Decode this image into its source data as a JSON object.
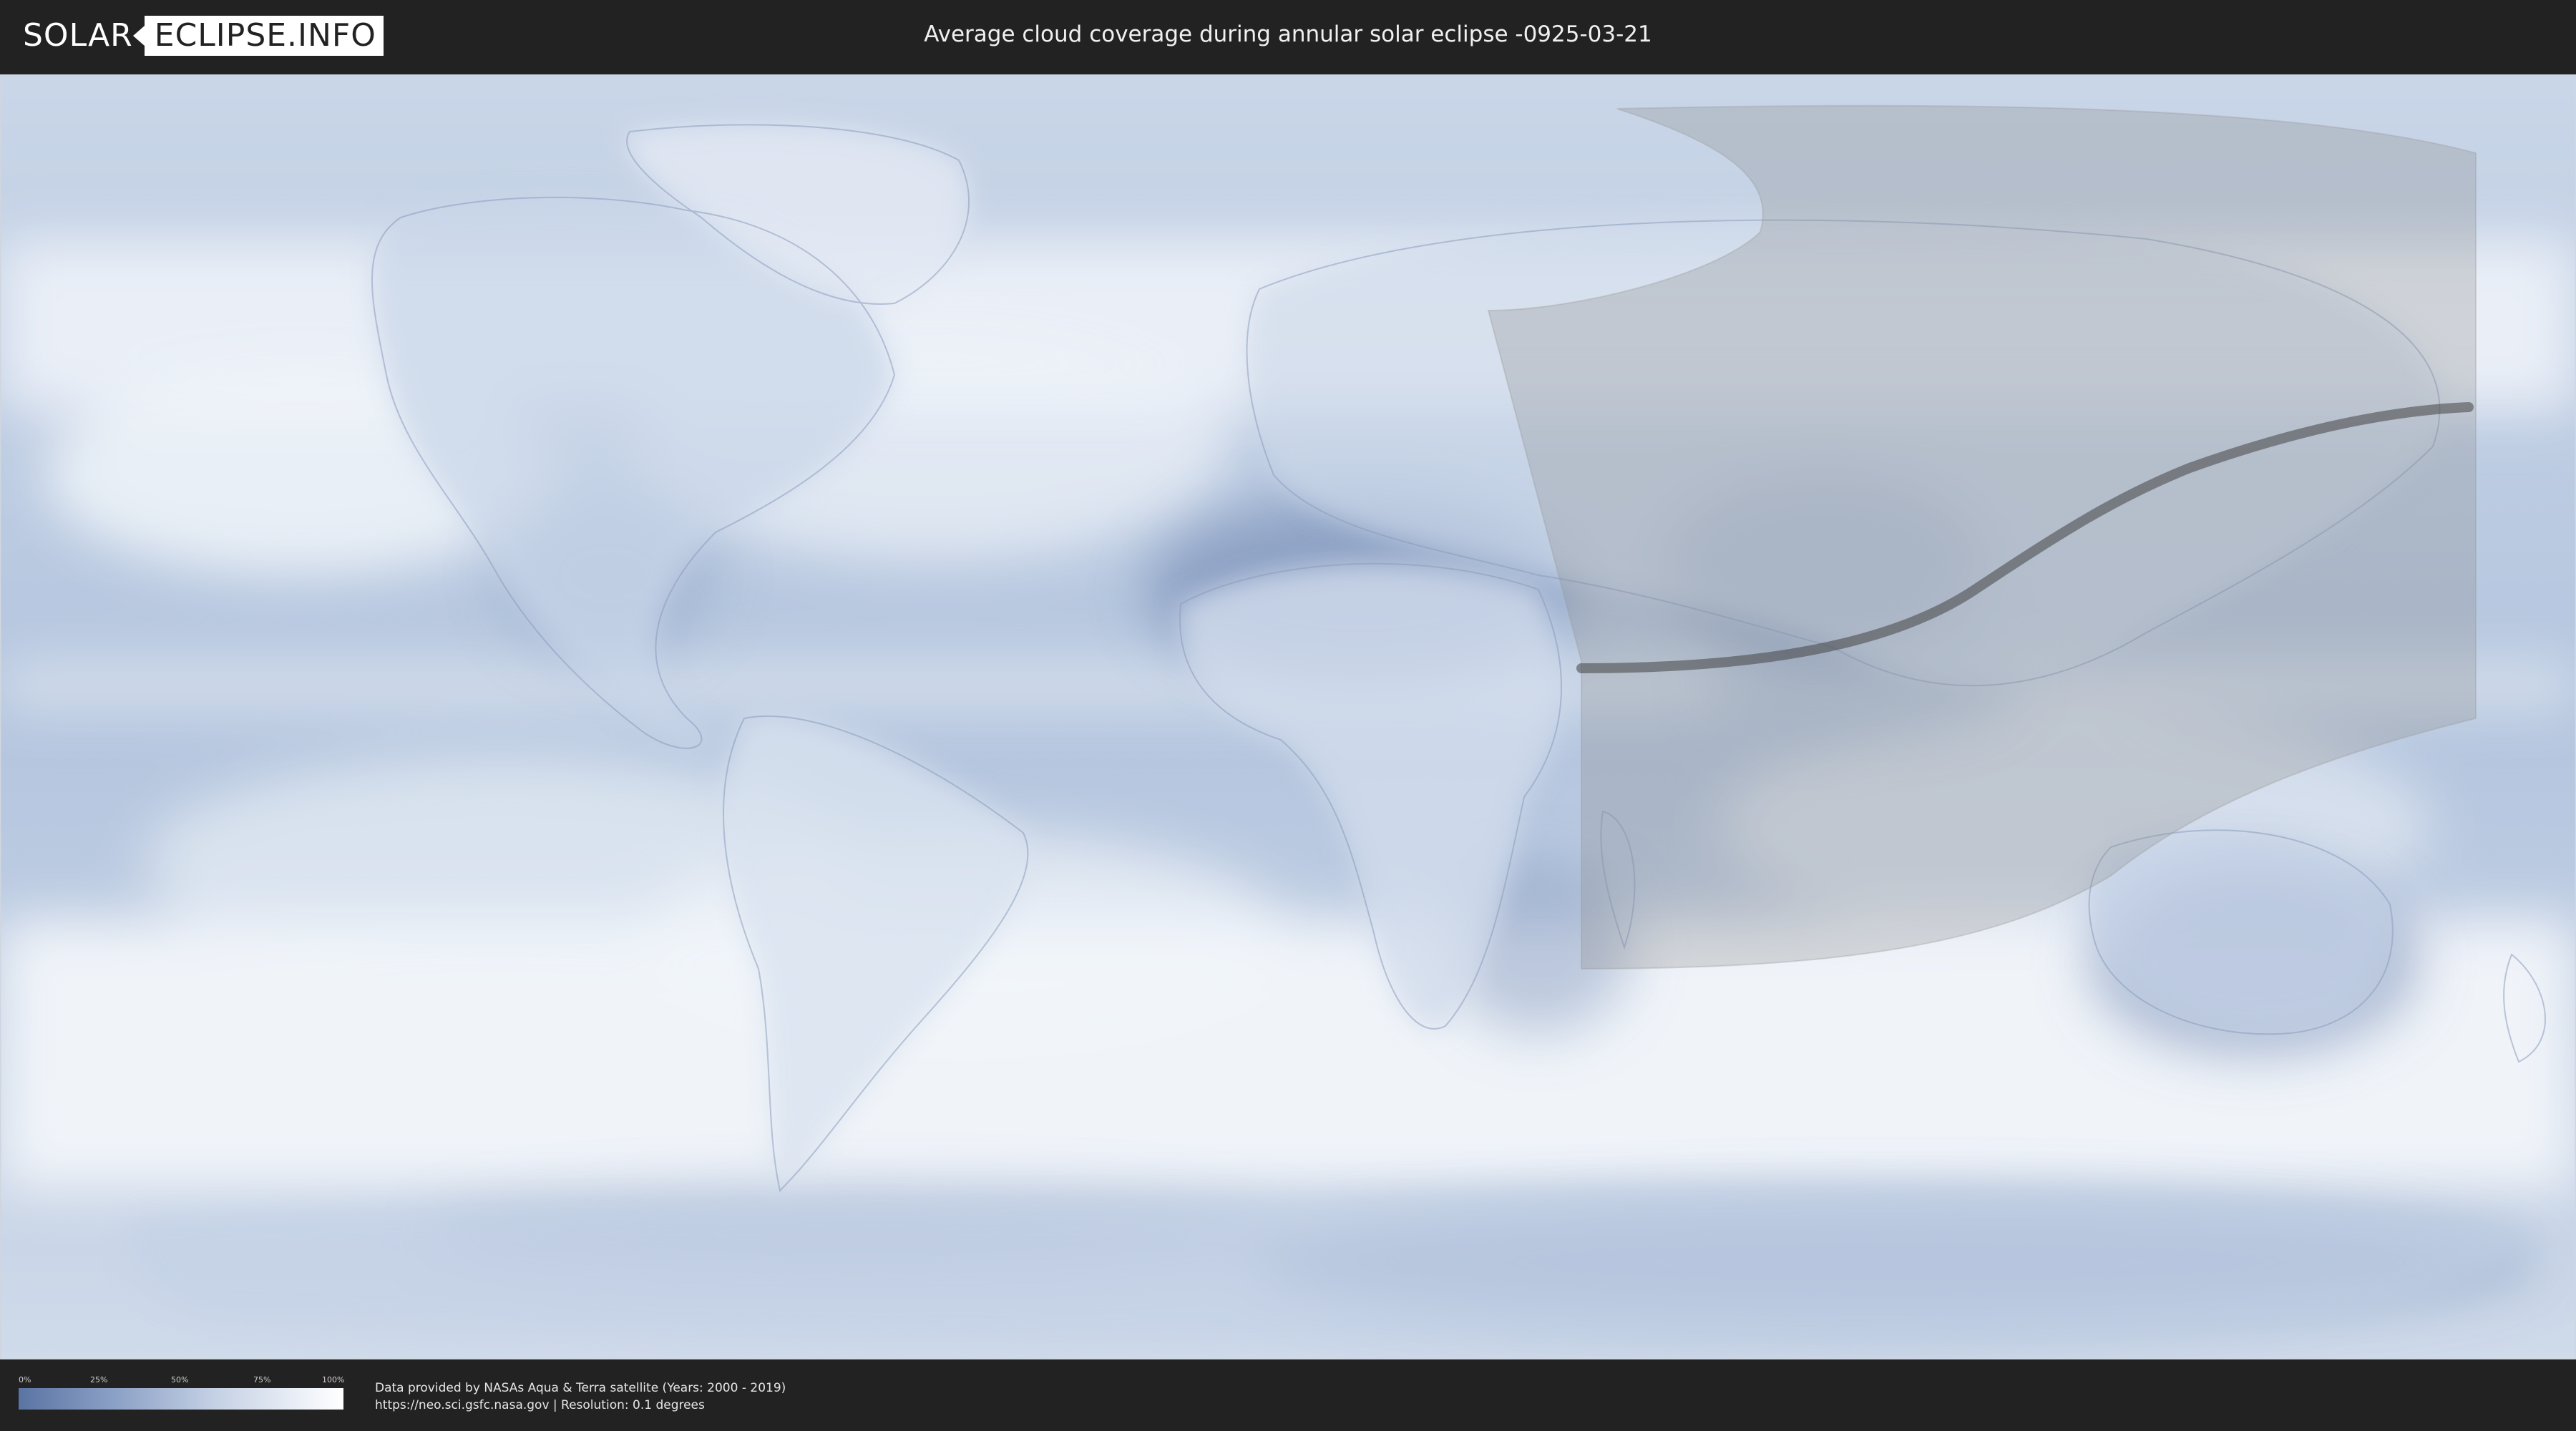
{
  "header": {
    "logo_left": "SOLAR",
    "logo_right": "ECLIPSE.INFO",
    "title": "Average cloud coverage during annular solar eclipse -0925-03-21"
  },
  "legend": {
    "ticks": [
      "0%",
      "25%",
      "50%",
      "75%",
      "100%"
    ],
    "colors": [
      "#5a74a3",
      "#8ca1c6",
      "#c4d0e4",
      "#e9eef6",
      "#ffffff"
    ]
  },
  "footer": {
    "line1": "Data provided by NASAs Aqua & Terra satellite (Years: 2000 - 2019)",
    "line2": "https://neo.sci.gsfc.nasa.gov | Resolution: 0.1 degrees"
  },
  "colors": {
    "background": "#222222",
    "ocean_base": "#b9c8de",
    "cloud_white": "#f4f7fb",
    "clear_sky": "#6a82ad",
    "eclipse_overlay": "#8a8a8a",
    "central_path": "#444444"
  }
}
